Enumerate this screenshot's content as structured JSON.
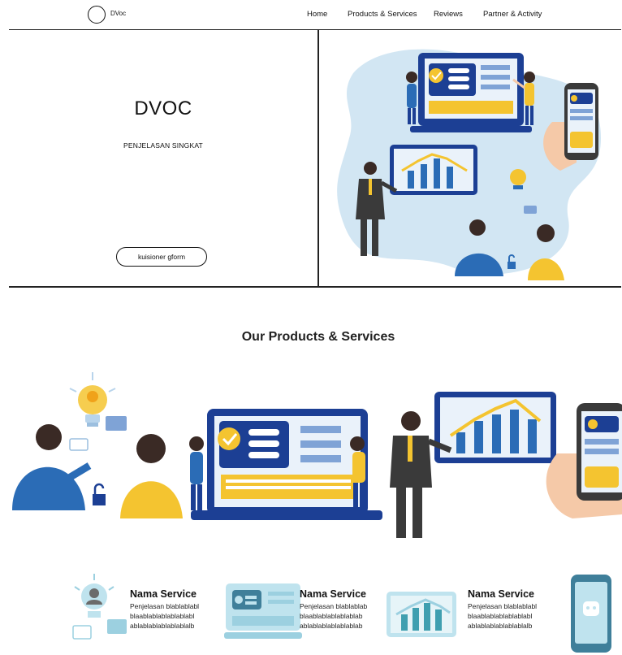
{
  "nav": {
    "brand": "DVoc",
    "links": [
      "Home",
      "Products & Services",
      "Reviews",
      "Partner & Activity"
    ]
  },
  "hero": {
    "title": "DVOC",
    "subtitle": "PENJELASAN SINGKAT",
    "cta_label": "kuisioner gform"
  },
  "products": {
    "section_title": "Our Products & Services",
    "cards": [
      {
        "title": "Nama Service",
        "desc": [
          "Penjelasan blablablabl",
          "blaablablablablablabl",
          "ablablablablablablalb"
        ]
      },
      {
        "title": "Nama Service",
        "desc": [
          "Penjelasan blablablab",
          "blaablablablablablab",
          "ablablablablablablab"
        ]
      },
      {
        "title": "Nama Service",
        "desc": [
          "Penjelasan blablablabl",
          "blaablablablablablabl",
          "ablablablablablablalb"
        ]
      }
    ]
  },
  "colors": {
    "navy": "#1c3f94",
    "blue": "#2b6cb6",
    "yellow": "#f4c430",
    "light_blue": "#d2e6f3",
    "teal_card": "#bfe3ee",
    "suit": "#3a3a3a",
    "skin": "#f5c9a8"
  }
}
